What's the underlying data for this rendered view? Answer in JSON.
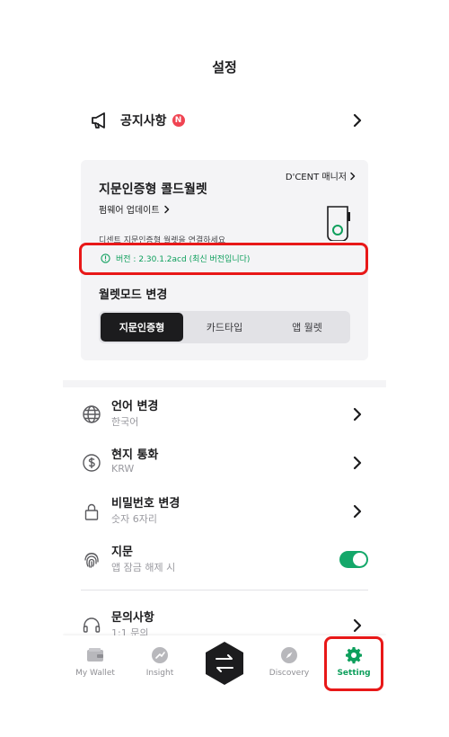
{
  "header": {
    "title": "설정"
  },
  "notice": {
    "label": "공지사항",
    "badge": "N"
  },
  "wallet_card": {
    "manager_link": "D'CENT 매니저",
    "title": "지문인증형 콜드월렛",
    "firmware_update": "펌웨어 업데이트",
    "connect_message": "디센트 지문인증형 월렛을 연결하세요",
    "version_text": "버전 : 2.30.1.2acd (최신 버전입니다)",
    "mode_title": "월렛모드 변경",
    "modes": [
      {
        "label": "지문인증형",
        "active": true
      },
      {
        "label": "카드타입",
        "active": false
      },
      {
        "label": "앱 월렛",
        "active": false
      }
    ]
  },
  "menu": {
    "items": [
      {
        "title": "언어 변경",
        "subtitle": "한국어",
        "icon": "globe-icon"
      },
      {
        "title": "현지 통화",
        "subtitle": "KRW",
        "icon": "dollar-icon"
      },
      {
        "title": "비밀번호 변경",
        "subtitle": "숫자 6자리",
        "icon": "lock-icon"
      },
      {
        "title": "지문",
        "subtitle": "앱 잠금 해제 시",
        "icon": "fingerprint-icon",
        "toggle": true
      },
      {
        "title": "문의사항",
        "subtitle": "1:1 문의",
        "icon": "headset-icon"
      }
    ]
  },
  "tabbar": {
    "tabs": [
      {
        "label": "My Wallet",
        "icon": "wallet-icon"
      },
      {
        "label": "Insight",
        "icon": "insight-icon"
      },
      {
        "label": "Discovery",
        "icon": "compass-icon"
      },
      {
        "label": "Setting",
        "icon": "gear-icon",
        "active": true
      }
    ]
  },
  "colors": {
    "accent_green": "#0d9f5c",
    "toggle_green": "#14a86a",
    "badge_red": "#f04452",
    "highlight_red": "#e81818",
    "card_bg": "#f4f4f6",
    "dark": "#1c1c1e"
  }
}
